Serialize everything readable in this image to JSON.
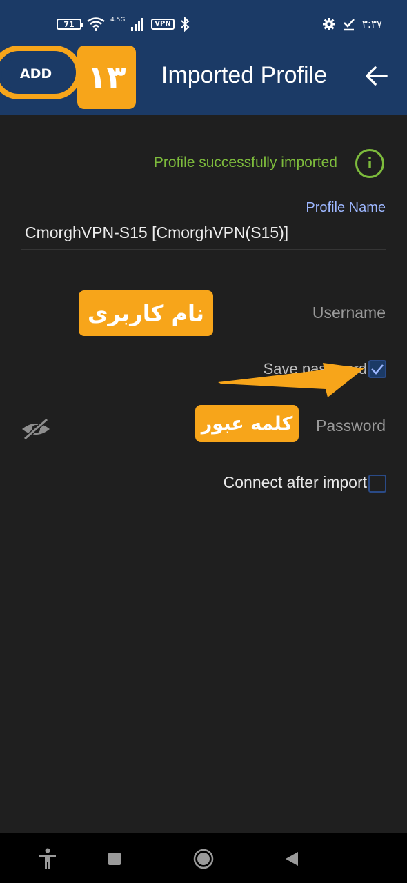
{
  "status_bar": {
    "battery": "71",
    "network": "4.5G",
    "vpn": "VPN",
    "time": "۳:۳۷"
  },
  "app_bar": {
    "add_label": "ADD",
    "step_number": "۱۳",
    "title": "Imported Profile"
  },
  "content": {
    "success_message": "Profile successfully imported",
    "profile_name_label": "Profile Name",
    "profile_name_value": "CmorghVPN-S15 [CmorghVPN(S15)]",
    "username_placeholder": "Username",
    "username_annotation": "نام کاربری",
    "save_password_label": "Save password",
    "save_password_checked": true,
    "password_placeholder": "Password",
    "password_annotation": "کلمه عبور",
    "connect_after_import_label": "Connect after import",
    "connect_after_import_checked": false
  },
  "colors": {
    "app_bar": "#1b3a66",
    "accent_orange": "#f7a51a",
    "success_green": "#7dbb3c",
    "label_blue": "#9db7ff",
    "background": "#1f1f1f"
  },
  "icons": [
    "battery-icon",
    "wifi-icon",
    "signal-icon",
    "bluetooth-icon",
    "gear-icon",
    "check-icon",
    "back-arrow-icon",
    "info-icon",
    "eye-off-icon",
    "accessibility-icon",
    "recents-icon",
    "home-icon",
    "back-icon"
  ]
}
